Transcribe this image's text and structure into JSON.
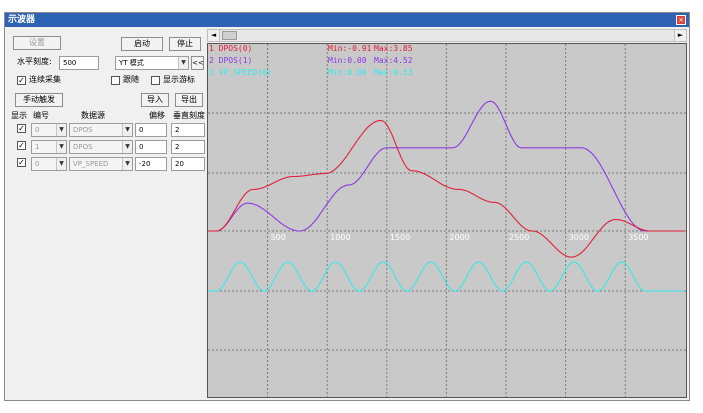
{
  "window": {
    "title": "示波器",
    "close_glyph": "×"
  },
  "toolbar": {
    "settings_label": "设置",
    "start_label": "启动",
    "stop_label": "停止",
    "hscale_label": "水平刻度:",
    "hscale_value": "500",
    "mode_value": "YT 模式",
    "collapse_label": "<<",
    "continuous_label": "连续采集",
    "continuous_checked": true,
    "follow_label": "跟随",
    "follow_checked": false,
    "show_cursor_label": "显示游标",
    "show_cursor_checked": false,
    "manual_trigger_label": "手动触发",
    "import_label": "导入",
    "export_label": "导出"
  },
  "channel_table": {
    "headers": [
      "显示",
      "编号",
      "数据源",
      "偏移",
      "垂直刻度"
    ],
    "rows": [
      {
        "show": true,
        "number": "0",
        "source": "DPOS",
        "offset": "0",
        "vscale": "2"
      },
      {
        "show": true,
        "number": "1",
        "source": "DPOS",
        "offset": "0",
        "vscale": "2"
      },
      {
        "show": true,
        "number": "0",
        "source": "VP_SPEED",
        "offset": "-20",
        "vscale": "20"
      }
    ]
  },
  "colors": {
    "plot_bg": "#c9c9c9",
    "grid": "#7a7a7a",
    "series0": "#e0203c",
    "series1": "#8a3be0",
    "series2": "#36e8e8",
    "tick_text": "#ffffff"
  },
  "scrollbar": {
    "left_glyph": "◄",
    "right_glyph": "►"
  },
  "chart_data": {
    "type": "line",
    "x_ticks": [
      "500",
      "1000",
      "1500",
      "2000",
      "2500",
      "3000",
      "3500"
    ],
    "series": [
      {
        "name": "1 DPOS(0)",
        "min_label": "Min:-0.91",
        "max_label": "Max:3.85"
      },
      {
        "name": "2 DPOS(1)",
        "min_label": "Min:0.00",
        "max_label": "Max:4.52"
      },
      {
        "name": "3 VP_SPEED(0)",
        "min_label": "Min:0.00",
        "max_label": "Max:0.53"
      }
    ]
  }
}
